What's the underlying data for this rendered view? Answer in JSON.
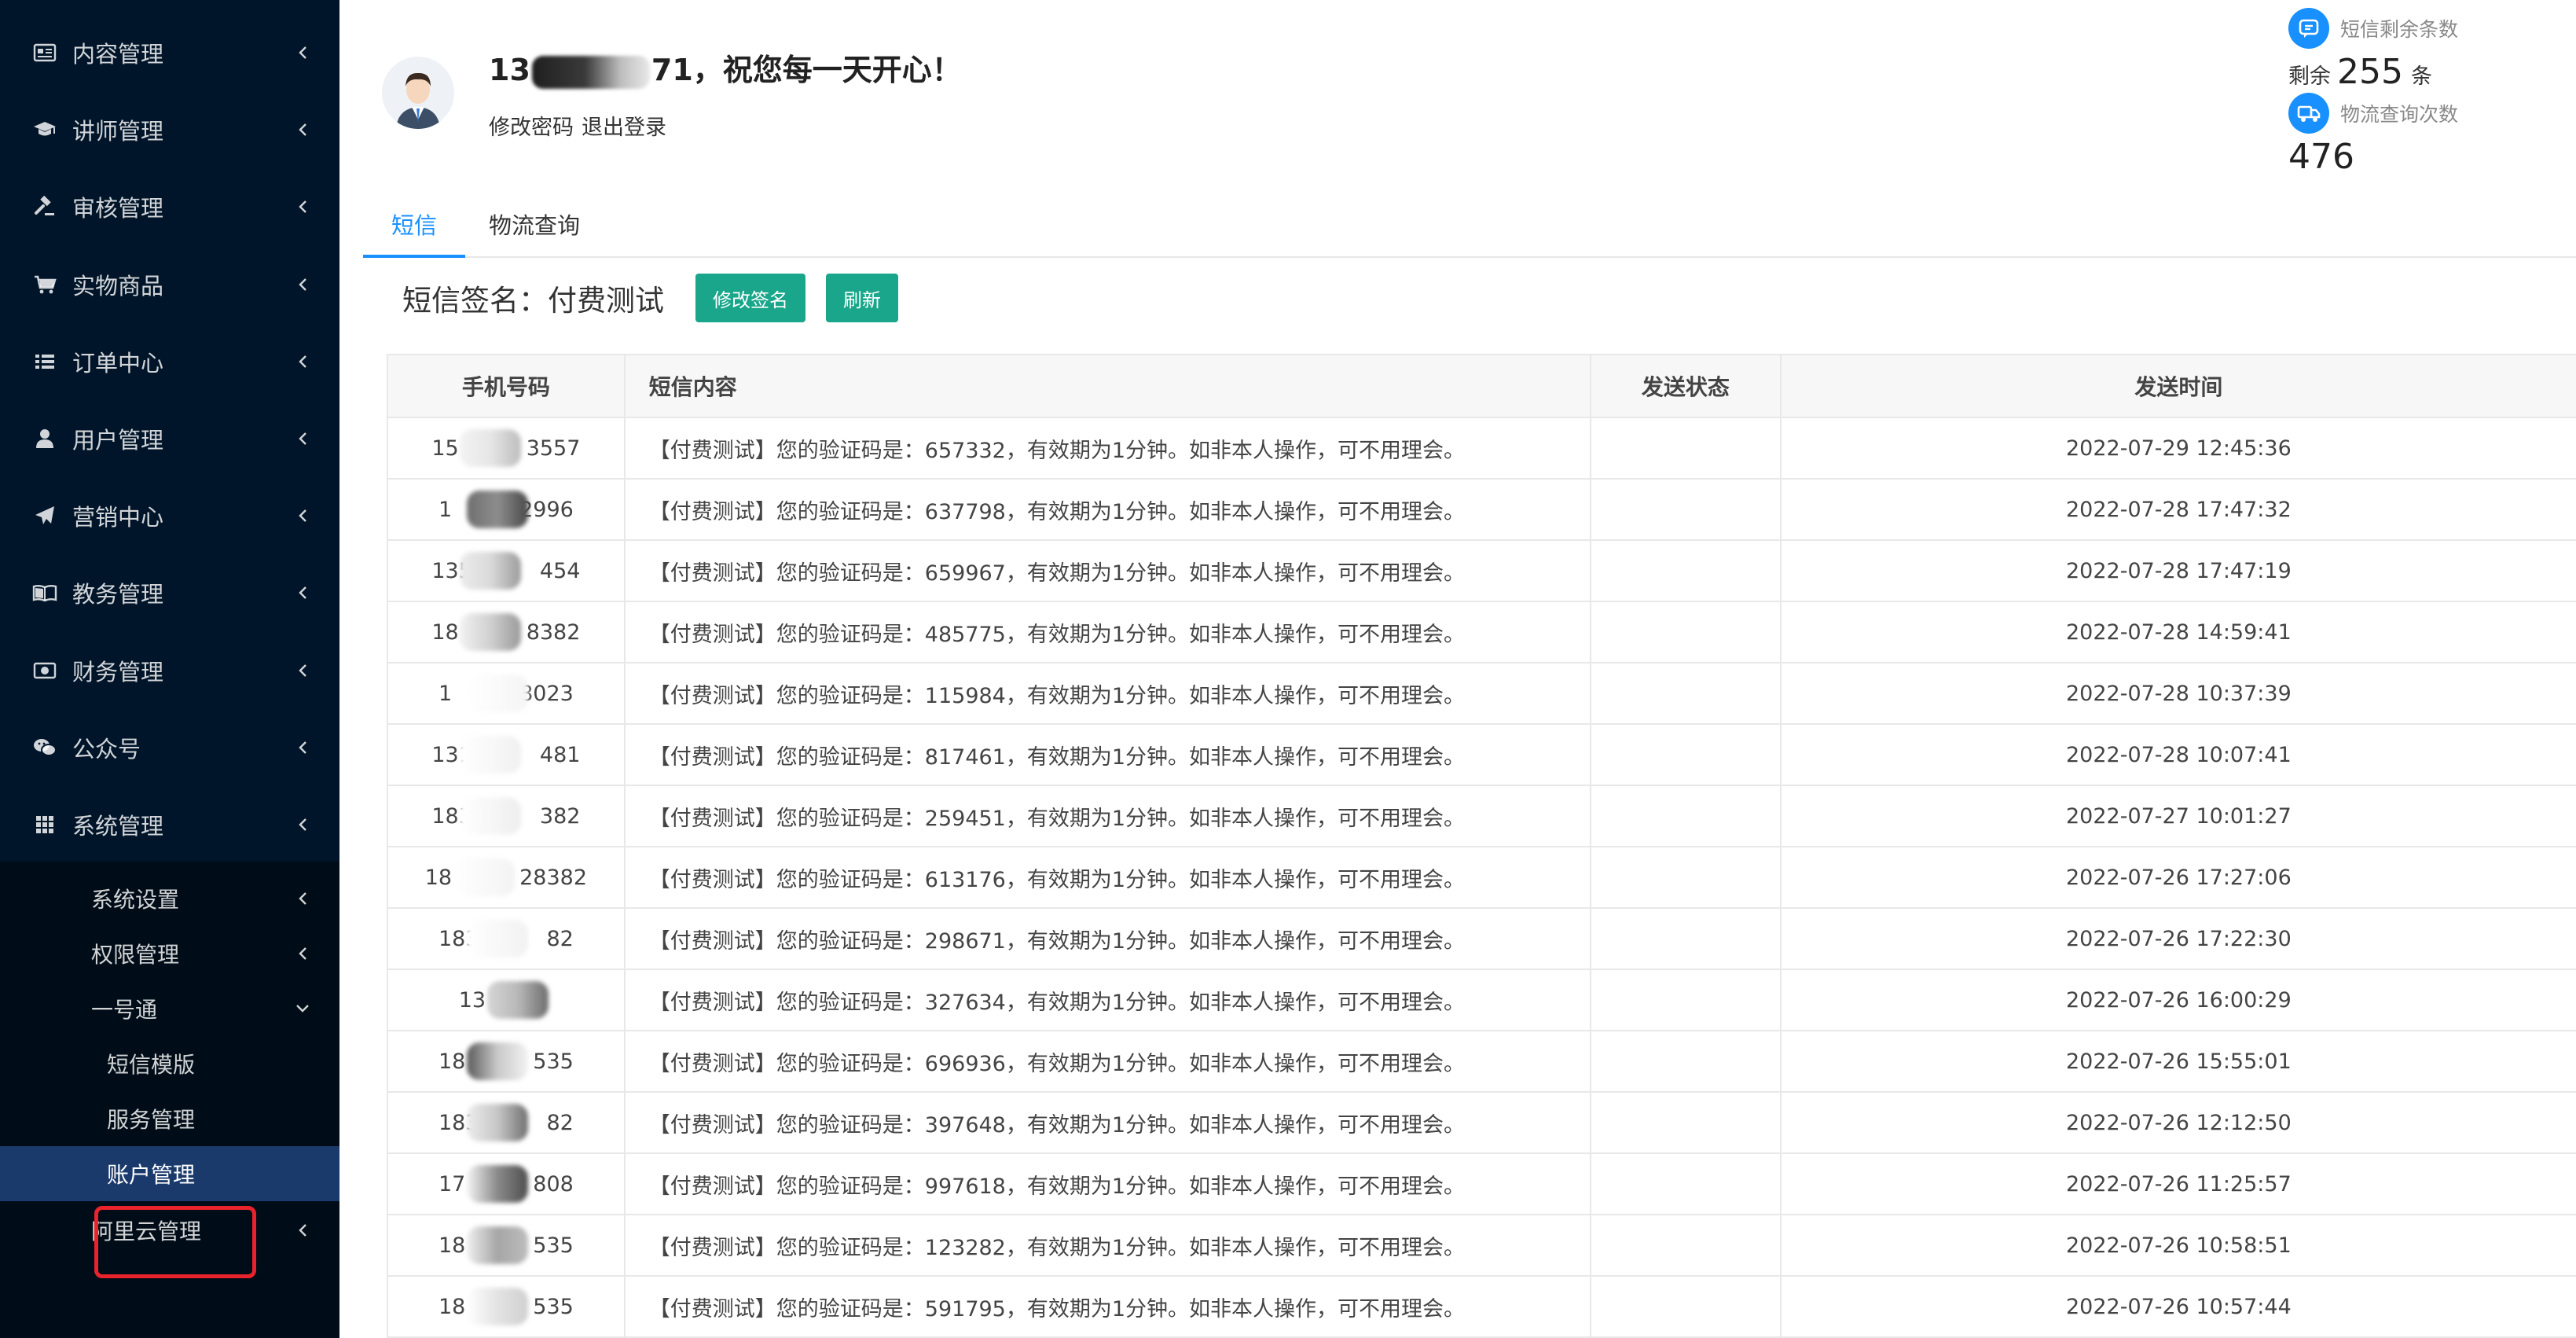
{
  "sidebar": {
    "menu": [
      {
        "label": "内容管理",
        "icon": "document-icon"
      },
      {
        "label": "讲师管理",
        "icon": "graduation-cap-icon"
      },
      {
        "label": "审核管理",
        "icon": "gavel-icon"
      },
      {
        "label": "实物商品",
        "icon": "cart-icon"
      },
      {
        "label": "订单中心",
        "icon": "list-icon"
      },
      {
        "label": "用户管理",
        "icon": "user-icon"
      },
      {
        "label": "营销中心",
        "icon": "paper-plane-icon"
      },
      {
        "label": "教务管理",
        "icon": "book-icon"
      },
      {
        "label": "财务管理",
        "icon": "money-icon"
      },
      {
        "label": "公众号",
        "icon": "wechat-icon"
      },
      {
        "label": "系统管理",
        "icon": "grid-icon"
      },
      {
        "label": "系统设置",
        "icon": "gear-icon"
      }
    ],
    "submenu": [
      {
        "label": "系统设置"
      },
      {
        "label": "权限管理"
      },
      {
        "label": "一号通"
      },
      {
        "label": "短信模版"
      },
      {
        "label": "服务管理"
      },
      {
        "label": "账户管理"
      },
      {
        "label": "阿里云管理"
      }
    ]
  },
  "header": {
    "greeting_prefix": "13",
    "greeting_suffix": "71，祝您每一天开心！",
    "change_password": "修改密码",
    "logout": "退出登录",
    "sms_label": "短信剩余条数",
    "sms_prefix": "剩余",
    "sms_count": "255",
    "sms_unit": "条",
    "logistics_label": "物流查询次数",
    "logistics_count": "476"
  },
  "tabs": [
    {
      "label": "短信"
    },
    {
      "label": "物流查询"
    }
  ],
  "toolbar": {
    "sign_label": "短信签名：付费测试",
    "edit_sign_button": "修改签名",
    "refresh_button": "刷新"
  },
  "table": {
    "columns": [
      "手机号码",
      "短信内容",
      "发送状态",
      "发送时间"
    ],
    "rows": [
      {
        "phone_a": "15",
        "phone_b": "3557",
        "content": "【付费测试】您的验证码是：657332，有效期为1分钟。如非本人操作，可不用理会。",
        "status": "",
        "time": "2022-07-29 12:45:36"
      },
      {
        "phone_a": "1",
        "phone_b": "2996",
        "content": "【付费测试】您的验证码是：637798，有效期为1分钟。如非本人操作，可不用理会。",
        "status": "",
        "time": "2022-07-28 17:47:32"
      },
      {
        "phone_a": "135",
        "phone_b": "454",
        "content": "【付费测试】您的验证码是：659967，有效期为1分钟。如非本人操作，可不用理会。",
        "status": "",
        "time": "2022-07-28 17:47:19"
      },
      {
        "phone_a": "18",
        "phone_b": "8382",
        "content": "【付费测试】您的验证码是：485775，有效期为1分钟。如非本人操作，可不用理会。",
        "status": "",
        "time": "2022-07-28 14:59:41"
      },
      {
        "phone_a": "1",
        "phone_b": "8023",
        "content": "【付费测试】您的验证码是：115984，有效期为1分钟。如非本人操作，可不用理会。",
        "status": "",
        "time": "2022-07-28 10:37:39"
      },
      {
        "phone_a": "131",
        "phone_b": "481",
        "content": "【付费测试】您的验证码是：817461，有效期为1分钟。如非本人操作，可不用理会。",
        "status": "",
        "time": "2022-07-28 10:07:41"
      },
      {
        "phone_a": "183",
        "phone_b": "382",
        "content": "【付费测试】您的验证码是：259451，有效期为1分钟。如非本人操作，可不用理会。",
        "status": "",
        "time": "2022-07-27 10:01:27"
      },
      {
        "phone_a": "18",
        "phone_b": "28382",
        "content": "【付费测试】您的验证码是：613176，有效期为1分钟。如非本人操作，可不用理会。",
        "status": "",
        "time": "2022-07-26 17:27:06"
      },
      {
        "phone_a": "183",
        "phone_b": "82",
        "content": "【付费测试】您的验证码是：298671，有效期为1分钟。如非本人操作，可不用理会。",
        "status": "",
        "time": "2022-07-26 17:22:30"
      },
      {
        "phone_a": "13",
        "phone_b": "",
        "content": "【付费测试】您的验证码是：327634，有效期为1分钟。如非本人操作，可不用理会。",
        "status": "",
        "time": "2022-07-26 16:00:29"
      },
      {
        "phone_a": "18",
        "phone_b": "535",
        "content": "【付费测试】您的验证码是：696936，有效期为1分钟。如非本人操作，可不用理会。",
        "status": "",
        "time": "2022-07-26 15:55:01"
      },
      {
        "phone_a": "183",
        "phone_b": "82",
        "content": "【付费测试】您的验证码是：397648，有效期为1分钟。如非本人操作，可不用理会。",
        "status": "",
        "time": "2022-07-26 12:12:50"
      },
      {
        "phone_a": "17",
        "phone_b": "808",
        "content": "【付费测试】您的验证码是：997618，有效期为1分钟。如非本人操作，可不用理会。",
        "status": "",
        "time": "2022-07-26 11:25:57"
      },
      {
        "phone_a": "18",
        "phone_b": "535",
        "content": "【付费测试】您的验证码是：123282，有效期为1分钟。如非本人操作，可不用理会。",
        "status": "",
        "time": "2022-07-26 10:58:51"
      },
      {
        "phone_a": "18",
        "phone_b": "535",
        "content": "【付费测试】您的验证码是：591795，有效期为1分钟。如非本人操作，可不用理会。",
        "status": "",
        "time": "2022-07-26 10:57:44"
      }
    ]
  },
  "colors": {
    "sidebar_bg": "#001529",
    "submenu_bg": "#000c17",
    "active_item_bg": "#1a3a6b",
    "accent_blue": "#1890ff",
    "button_green": "#19a68a",
    "highlight_red": "#e8232b"
  }
}
